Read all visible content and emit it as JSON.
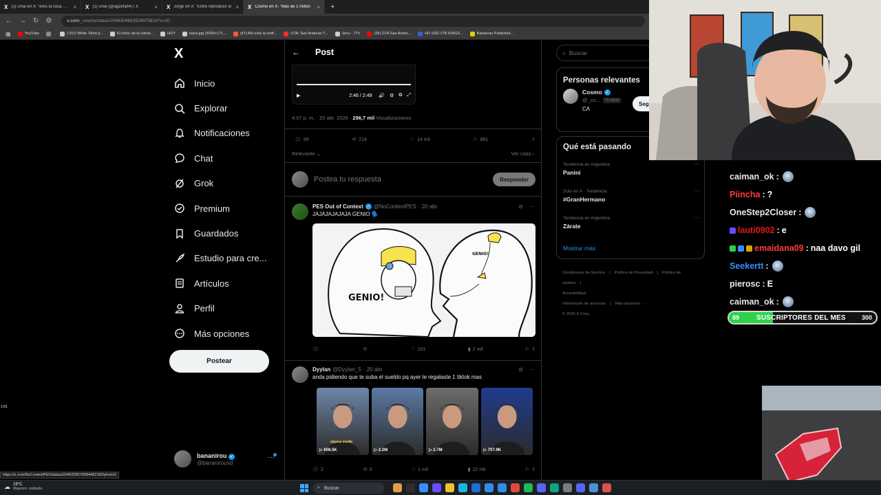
{
  "browser": {
    "tabs": [
      {
        "title": "(1) Unai en X: \"eres la cosa más",
        "active": false
      },
      {
        "title": "(1) Unai (@agzehpt4) / X",
        "active": false
      },
      {
        "title": "Jorge en X: \"Entre reproducir el",
        "active": false
      },
      {
        "title": "Cosmo en X: \"Más de 1 millón",
        "active": true
      }
    ],
    "url_host": "x.com",
    "url_path": "/_cosmo/status/2046304863529975816?s=20",
    "bookmarks": [
      {
        "label": "YouTube",
        "color": "#ff0000"
      },
      {
        "label": "",
        "color": "#888888"
      },
      {
        "label": "LSV2 White Tshirt p...",
        "color": "#cccccc"
      },
      {
        "label": "El chico de la camis...",
        "color": "#cccccc"
      },
      {
        "label": "HOY",
        "color": "#cccccc"
      },
      {
        "label": "bana.jpg (3000×171...",
        "color": "#cccccc"
      },
      {
        "label": "(47) Ahí esta la notif...",
        "color": "#ff5a36"
      },
      {
        "label": "GTA: San Andreas T...",
        "color": "#ff2b2b"
      },
      {
        "label": "Jerry - 77V",
        "color": "#cccccc"
      },
      {
        "label": "(28) GTA San Andre...",
        "color": "#ff0000"
      },
      {
        "label": "HD SSD 1TB KINGS...",
        "color": "#3a5bd9"
      },
      {
        "label": "Banderas Publicitari...",
        "color": "#d9d400"
      }
    ]
  },
  "left_nav": {
    "logo": "X",
    "items": [
      {
        "label": "Inicio",
        "icon": "home-icon"
      },
      {
        "label": "Explorar",
        "icon": "search-icon"
      },
      {
        "label": "Notificaciones",
        "icon": "bell-icon"
      },
      {
        "label": "Chat",
        "icon": "chat-icon"
      },
      {
        "label": "Grok",
        "icon": "grok-icon"
      },
      {
        "label": "Premium",
        "icon": "premium-icon"
      },
      {
        "label": "Guardados",
        "icon": "bookmark-icon"
      },
      {
        "label": "Estudio para cre...",
        "icon": "rocket-icon"
      },
      {
        "label": "Artículos",
        "icon": "article-icon"
      },
      {
        "label": "Perfil",
        "icon": "profile-icon"
      },
      {
        "label": "Más opciones",
        "icon": "more-icon"
      }
    ],
    "post_button": "Postear",
    "account": {
      "name": "bananirou",
      "handle": "@bananirouxd",
      "more": "···"
    }
  },
  "status_bar_url": "https://x.com/NoContextPES/status/2046328276994462182/photo/1",
  "center": {
    "title": "Post",
    "video": {
      "time": "2:46 / 2:49"
    },
    "meta": {
      "time": "4:07 p. m. · 20 abr. 2026 ·",
      "views": "296,7 mil",
      "views_label": "Visualizaciones"
    },
    "stats": {
      "replies": "99",
      "reposts": "214",
      "likes": "14 mil",
      "bookmarks": "881"
    },
    "sort_label": "Relevante",
    "quotes_label": "Ver citas",
    "reply_placeholder": "Postea tu respuesta",
    "reply_button": "Responder",
    "tweets": [
      {
        "name": "PES Out of Context",
        "handle": "@NoContextPES",
        "date": "· 20 abr.",
        "text": "JAJAJAJAJAJA GENIO 🗣️",
        "meme_label": "GENIO!",
        "meme_small_label": "GENIO!",
        "actions": {
          "replies": "",
          "reposts": "",
          "likes": "101",
          "views": "2 mil"
        }
      },
      {
        "name": "Dyylan",
        "handle": "@Dyylan_5",
        "date": "· 20 abr.",
        "text": "anda pidiendo que te suba el sueldo pq ayer le regalaste 1 tiktok mas",
        "thumbs": [
          {
            "views": "608.5K",
            "caption": "alguna media",
            "color": "#6f86a8"
          },
          {
            "views": "2.2M",
            "caption": "",
            "color": "#5b7aa4"
          },
          {
            "views": "2.7M",
            "caption": "",
            "color": "#6d6d6d"
          },
          {
            "views": "707.9K",
            "caption": "",
            "color": "#1f3c8f"
          }
        ],
        "actions": {
          "replies": "2",
          "reposts": "3",
          "likes": "1 mil",
          "views": "22 mil"
        }
      }
    ]
  },
  "right": {
    "search_placeholder": "Buscar",
    "relevant": {
      "title": "Personas relevantes",
      "user": {
        "name": "Cosmo",
        "handle": "@_co...",
        "follows_you": "Te sigue",
        "bio": "CA"
      },
      "follow_button": "Seg"
    },
    "trending": {
      "title": "Qué está pasando",
      "items": [
        {
          "context": "Tendencia en Argentina",
          "name": "Panini"
        },
        {
          "context": "Solo en X · Tendencia",
          "name": "#GranHermano"
        },
        {
          "context": "Tendencia en Argentina",
          "name": "Zárate"
        }
      ],
      "show_more": "Mostrar más"
    },
    "footer": [
      "Condiciones de Servicio",
      "|",
      "Política de Privacidad",
      "|",
      "Política de cookies",
      "|",
      "Accesibilidad",
      "Información de anuncios",
      "|",
      "Más opciones ···",
      "© 2026 X Corp."
    ]
  },
  "stream": {
    "chat": [
      {
        "user": "caiman_ok",
        "color": "#e8e8e8",
        "msg": "",
        "emote": true,
        "badges": []
      },
      {
        "user": "Piincha",
        "color": "#ff3b3b",
        "msg": "?",
        "emote": false,
        "badges": []
      },
      {
        "user": "OneStep2Closer",
        "color": "#e8e8e8",
        "msg": "",
        "emote": true,
        "badges": []
      },
      {
        "user": "lauti0902",
        "color": "#e01818",
        "msg": "e",
        "emote": false,
        "badges": [
          "#6b4cff"
        ]
      },
      {
        "user": "emaidana09",
        "color": "#ff3b3b",
        "msg": "naa davo gil",
        "emote": false,
        "badges": [
          "#2fd14a",
          "#3b8cff",
          "#d9a400"
        ]
      },
      {
        "user": "Seekertt",
        "color": "#3b8cff",
        "msg": "",
        "emote": true,
        "badges": []
      },
      {
        "user": "pierosc",
        "color": "#e8e8e8",
        "msg": "E",
        "emote": false,
        "badges": []
      },
      {
        "user": "caiman_ok",
        "color": "#e8e8e8",
        "msg": "",
        "emote": true,
        "badges": []
      }
    ],
    "sub_goal": {
      "current": "89",
      "label": "SUSCRIPTORES DEL MES",
      "target": "300",
      "progress": 0.297
    },
    "side_badge": "1:01"
  },
  "taskbar": {
    "weather_temp": "19°C",
    "weather_desc": "Mayorm. nublado",
    "search_label": "Buscar",
    "apps": [
      "#e0a04a",
      "#2d2d2d",
      "#3b8cff",
      "#6b4cff",
      "#f2c12e",
      "#1db3e0",
      "#1d6fd1",
      "#2f8de6",
      "#2f8de6",
      "#e04a3b",
      "#1db954",
      "#5865f2",
      "#10a37f",
      "#7b7b7b",
      "#5865f2",
      "#4a90d9",
      "#d9534f"
    ]
  }
}
